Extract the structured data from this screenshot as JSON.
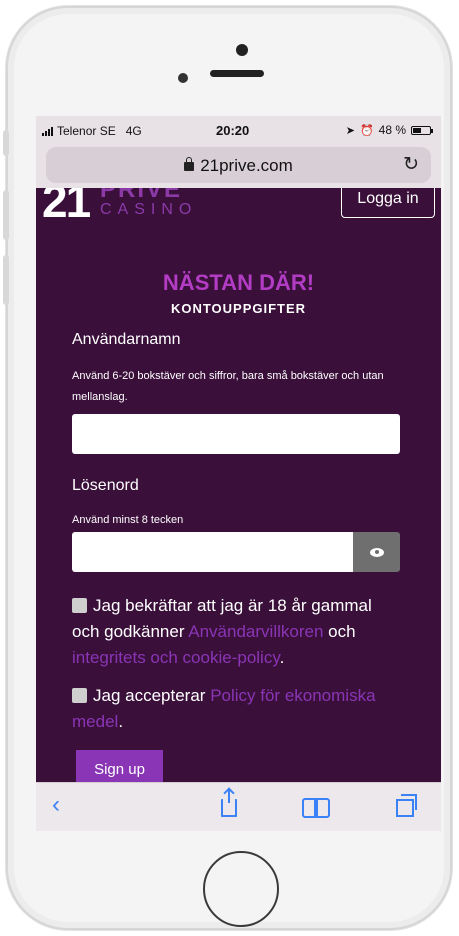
{
  "status_bar": {
    "carrier": "Telenor SE",
    "network": "4G",
    "time": "20:20",
    "battery": "48 %"
  },
  "browser": {
    "url": "21prive.com",
    "reload_icon": "reload-icon",
    "toolbar_icons": [
      "back-arrow-icon",
      "share-icon",
      "bookmarks-icon",
      "tabs-icon"
    ]
  },
  "site": {
    "logo_number": "21",
    "logo_brand": "PRIVE",
    "logo_sub": "CASINO",
    "login_button": "Logga in"
  },
  "form": {
    "heading": "NÄSTAN DÄR!",
    "subheading": "KONTOUPPGIFTER",
    "username": {
      "label": "Användarnamn",
      "hint": "Använd 6-20 bokstäver och siffror, bara små bokstäver och utan mellanslag.",
      "value": ""
    },
    "password": {
      "label": "Lösenord",
      "hint": "Använd minst 8 tecken",
      "value": ""
    },
    "age_consent": {
      "text_before": "Jag bekräftar att jag är 18 år gammal och godkänner ",
      "link_terms": "Användarvillkoren",
      "text_middle": " och ",
      "link_privacy": "integritets och cookie-policy",
      "text_after": "."
    },
    "finance_consent": {
      "text_before": "Jag accepterar ",
      "link_policy": "Policy för ekonomiska medel",
      "text_after": "."
    },
    "submit_label": "Sign up"
  },
  "colors": {
    "page_background": "#3a0f3a",
    "accent": "#8a35b5",
    "heading": "#b23cc4",
    "ios_blue": "#3b82f6"
  }
}
